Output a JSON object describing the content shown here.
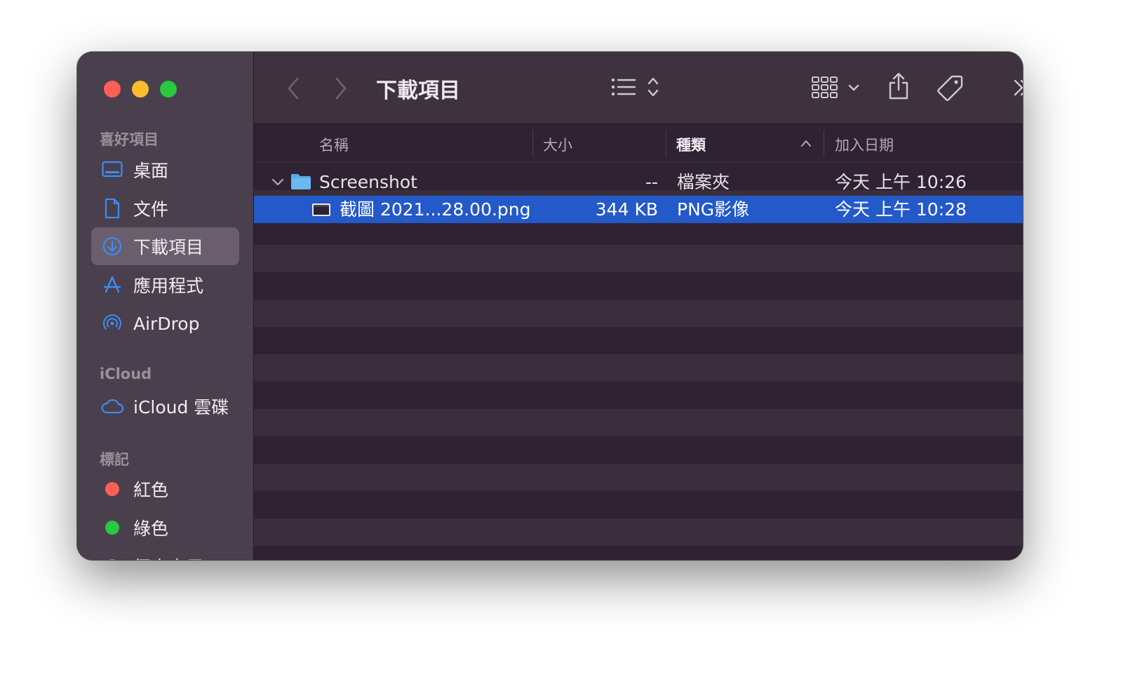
{
  "window": {
    "title": "下載項目"
  },
  "sidebar": {
    "favorites_header": "喜好項目",
    "favorites": [
      {
        "label": "桌面",
        "icon": "desktop-icon"
      },
      {
        "label": "文件",
        "icon": "document-icon"
      },
      {
        "label": "下載項目",
        "icon": "downloads-icon",
        "selected": true
      },
      {
        "label": "應用程式",
        "icon": "applications-icon"
      },
      {
        "label": "AirDrop",
        "icon": "airdrop-icon"
      }
    ],
    "icloud_header": "iCloud",
    "icloud": [
      {
        "label": "iCloud 雲碟",
        "icon": "cloud-icon"
      }
    ],
    "tags_header": "標記",
    "tags": [
      {
        "label": "紅色",
        "color": "#ff5f57"
      },
      {
        "label": "綠色",
        "color": "#28c840"
      },
      {
        "label": "個人專用"
      }
    ]
  },
  "toolbar": {
    "title": "下載項目",
    "icons": [
      "back-icon",
      "forward-icon",
      "list-view-icon",
      "group-icon",
      "share-icon",
      "tag-icon",
      "more-icon",
      "search-icon"
    ]
  },
  "columns": {
    "name": "名稱",
    "size": "大小",
    "kind": "種類",
    "date_added": "加入日期"
  },
  "files": [
    {
      "name": "Screenshot",
      "size": "--",
      "kind": "檔案夾",
      "date_added": "今天 上午 10:26",
      "type": "folder",
      "expanded": true
    },
    {
      "name": "截圖 2021...28.00.png",
      "size": "344 KB",
      "kind": "PNG影像",
      "date_added": "今天 上午 10:28",
      "type": "image",
      "selected": true
    }
  ],
  "colors": {
    "accent": "#2359c8",
    "sidebar_icon": "#3b8df5",
    "folder": "#6cb8f0"
  }
}
